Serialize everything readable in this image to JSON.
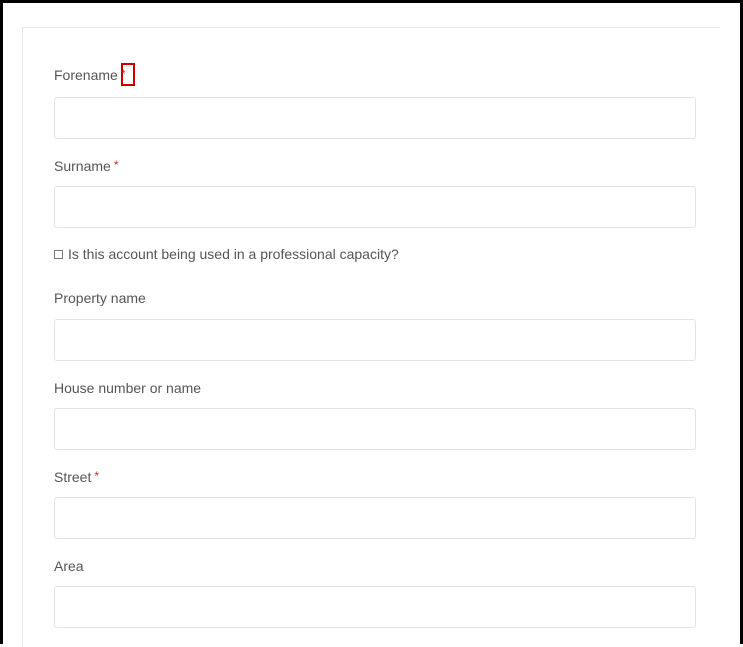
{
  "form": {
    "forename": {
      "label": "Forename",
      "required_mark": "*",
      "value": "",
      "placeholder": ""
    },
    "surname": {
      "label": "Surname",
      "required_mark": "*",
      "value": "",
      "placeholder": ""
    },
    "professional_checkbox": {
      "label": "Is this account being used in a professional capacity?",
      "checked": false
    },
    "property_name": {
      "label": "Property name",
      "value": "",
      "placeholder": ""
    },
    "house_number": {
      "label": "House number or name",
      "value": "",
      "placeholder": ""
    },
    "street": {
      "label": "Street",
      "required_mark": "*",
      "value": "",
      "placeholder": ""
    },
    "area": {
      "label": "Area",
      "value": "",
      "placeholder": ""
    }
  },
  "colors": {
    "required_asterisk": "#c9302c",
    "highlight_box": "#d00000",
    "input_border": "#e3e3e3",
    "label_text": "#555555"
  }
}
